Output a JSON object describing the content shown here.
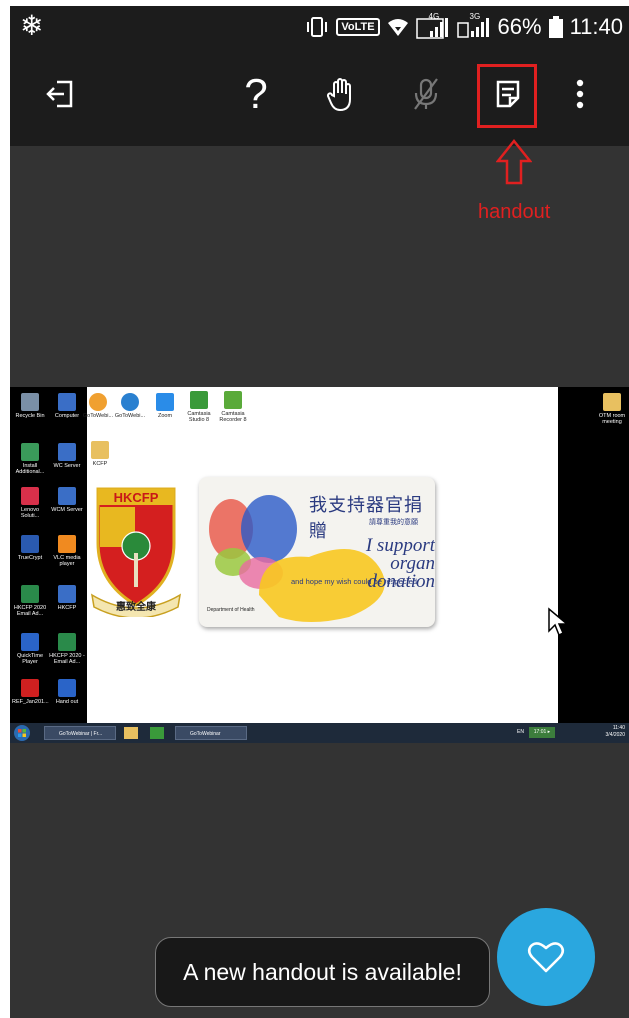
{
  "status_bar": {
    "volte": "VoLTE",
    "net1": "4G",
    "net2": "3G",
    "battery": "66%",
    "time": "11:40"
  },
  "toolbar": {
    "icons": [
      "exit-icon",
      "help-icon",
      "raise-hand-icon",
      "mic-muted-icon",
      "handout-icon",
      "more-menu-icon"
    ],
    "help_glyph": "?"
  },
  "annotation": {
    "label": "handout",
    "color": "#e02020"
  },
  "shared_screen": {
    "left_icons": [
      [
        "Recycle Bin",
        "Computer"
      ],
      [
        "Install Additional...",
        "WC Server"
      ],
      [
        "Lenovo Soluti...",
        "WCM Server"
      ],
      [
        "TrueCrypt",
        "VLC media player"
      ],
      [
        "HKCFP 2020 Email Ad...",
        "HKCFP"
      ],
      [
        "QuickTime Player",
        "HKCFP 2020 - Email Ad..."
      ],
      [
        "REF_Jan201...",
        "Hand out"
      ]
    ],
    "top_icons": [
      "GoToWebi...",
      "GoToWebi...",
      "Zoom",
      "Camtasia Studio 8",
      "Camtasia Recorder 8"
    ],
    "folder_icon_label": "KCFP",
    "right_icon": "OTM room meeting",
    "crest_letters": "HKCFP",
    "crest_motto": "惠致全康",
    "card_title": "我支持器官捐贈",
    "card_sub": "請尊重我的意願",
    "card_support_1": "I support",
    "card_support_2": "organ donation",
    "card_hope": "and hope my wish could be respected",
    "card_dept": "Department of Health",
    "taskbar_task1": "GoToWebinar | Fr...",
    "taskbar_task2": "GoToWebinar",
    "taskbar_lang": "EN",
    "taskbar_badge": "17:01 ▸",
    "taskbar_time": "11:40",
    "taskbar_date": "3/4/2020"
  },
  "toast": {
    "message": "A new handout is available!"
  },
  "fab": {
    "icon": "heart-icon",
    "color": "#2aa7df"
  }
}
